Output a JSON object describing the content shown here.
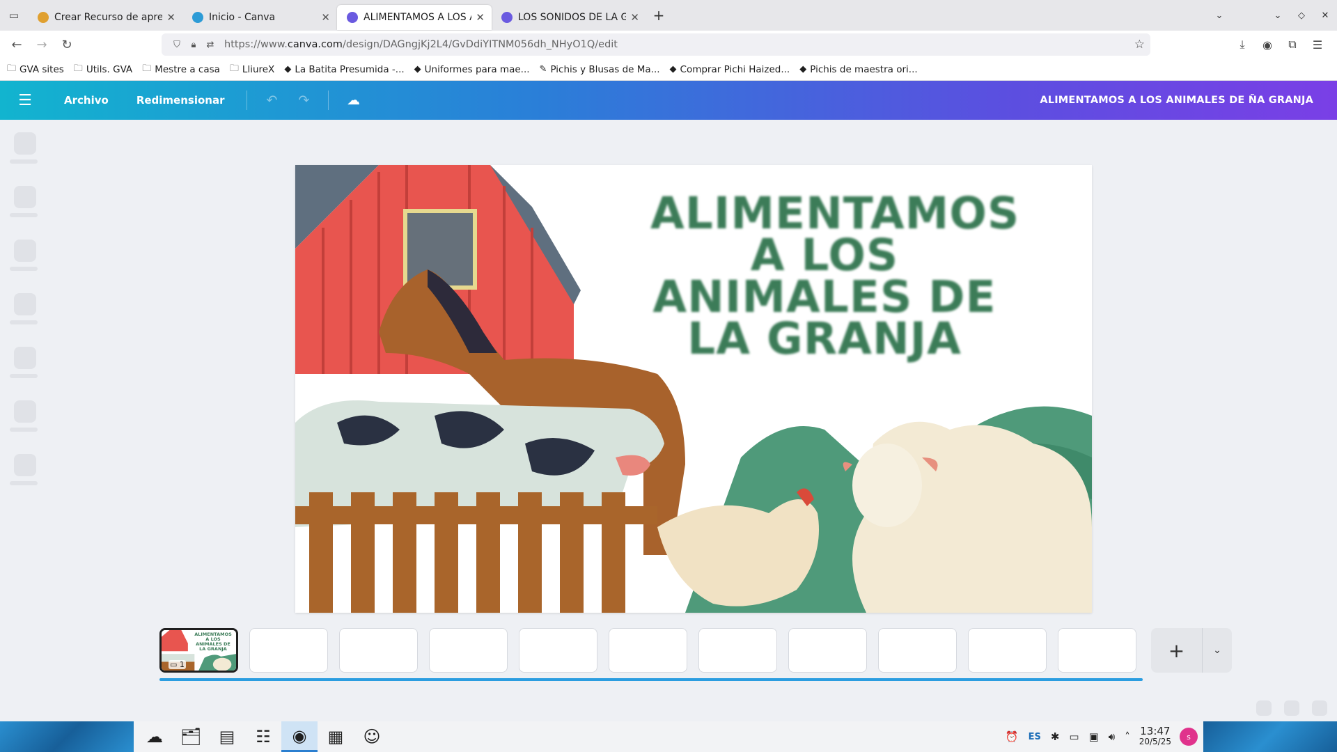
{
  "browser": {
    "tabs": [
      {
        "title": "Crear Recurso de aprendiz",
        "favicon_color": "#e0a030",
        "active": false
      },
      {
        "title": "Inicio - Canva",
        "favicon_color": "#2c9bd6",
        "active": false
      },
      {
        "title": "ALIMENTAMOS A LOS ANIM",
        "favicon_color": "#6a5ae0",
        "active": true
      },
      {
        "title": "LOS SONIDOS DE LA GRAN",
        "favicon_color": "#6a5ae0",
        "active": false
      }
    ],
    "url_prefix": "https://www.",
    "url_domain": "canva.com",
    "url_path": "/design/DAGngjKj2L4/GvDdiYITNM056dh_NHyO1Q/edit",
    "bookmarks": [
      {
        "label": "GVA sites",
        "icon": "folder-icon"
      },
      {
        "label": "Utils. GVA",
        "icon": "folder-icon"
      },
      {
        "label": "Mestre a casa",
        "icon": "folder-icon"
      },
      {
        "label": "LliureX",
        "icon": "folder-icon"
      },
      {
        "label": "La Batita Presumida -...",
        "icon": "site-icon"
      },
      {
        "label": "Uniformes para mae...",
        "icon": "site-icon"
      },
      {
        "label": "Pichis y Blusas de Ma...",
        "icon": "pencil-icon"
      },
      {
        "label": "Comprar Pichi Haized...",
        "icon": "site-icon"
      },
      {
        "label": "Pichis de maestra ori...",
        "icon": "site-icon"
      }
    ]
  },
  "canva": {
    "menu_file": "Archivo",
    "menu_resize": "Redimensionar",
    "design_title": "ALIMENTAMOS A LOS ANIMALES DE ÑA GRANJA",
    "slide_title_lines": [
      "ALIMENTAMOS",
      "A LOS",
      "ANIMALES DE",
      "LA GRANJA"
    ],
    "thumb_title": "ALIMENTAMOS A LOS ANIMALES DE LA GRANJA",
    "thumb_comment_count": "1",
    "page_count": 11,
    "accent_color": "#2b9de0"
  },
  "taskbar": {
    "language": "ES",
    "time": "13:47",
    "date": "20/5/25",
    "avatar_initial": "s"
  }
}
